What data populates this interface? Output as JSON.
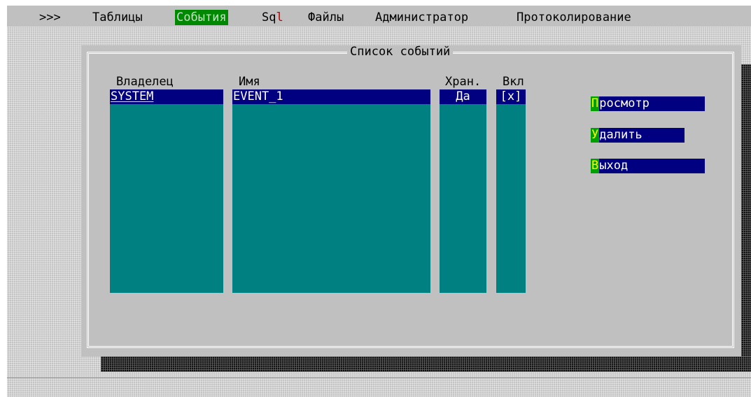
{
  "menubar": {
    "items": [
      {
        "label": ">>>"
      },
      {
        "label": "Таблицы"
      },
      {
        "label": "События"
      },
      {
        "label_prefix": "Sq",
        "label_mark": "l"
      },
      {
        "label": "Файлы"
      },
      {
        "label": "Администратор"
      },
      {
        "label": "Протоколирование"
      }
    ],
    "active_index": 2
  },
  "dialog": {
    "title": "Список событий",
    "columns": {
      "owner": "Владелец",
      "name": "Имя",
      "stored": "Хран.",
      "enabled": "Вкл"
    },
    "rows": [
      {
        "owner": "SYSTEM",
        "name": "EVENT_1",
        "stored": "Да",
        "enabled": "[x]"
      }
    ],
    "buttons": {
      "view": {
        "hotkey": "П",
        "rest": "росмотр"
      },
      "delete": {
        "hotkey": "У",
        "rest": "далить"
      },
      "exit": {
        "hotkey": "В",
        "rest": "ыход"
      }
    }
  },
  "colors": {
    "background": "#c0c0c0",
    "list": "#008080",
    "selection": "#000080",
    "active_menu": "#008800",
    "hotkey_bg": "#00a000",
    "hotkey_fg": "#ffff00"
  }
}
